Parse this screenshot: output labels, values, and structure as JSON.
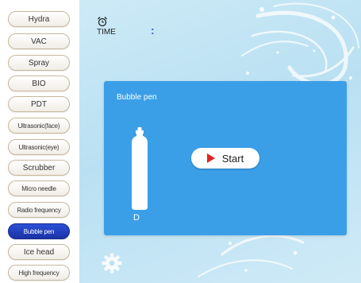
{
  "sidebar": {
    "items": [
      {
        "label": "Hydra"
      },
      {
        "label": "VAC"
      },
      {
        "label": "Spray"
      },
      {
        "label": "BIO"
      },
      {
        "label": "PDT"
      },
      {
        "label": "Ultrasonic(face)"
      },
      {
        "label": "Ultrasonic(eye)"
      },
      {
        "label": "Scrubber"
      },
      {
        "label": "Micro needle"
      },
      {
        "label": "Radio frequency"
      },
      {
        "label": "Bubble pen",
        "active": true
      },
      {
        "label": "Ice head"
      },
      {
        "label": "High frequency"
      }
    ]
  },
  "header": {
    "time_label": "TIME",
    "time_value": ":",
    "clock_icon": "alarm-clock-icon"
  },
  "panel": {
    "title": "Bubble pen",
    "pen_label": "D",
    "pen_icon": "bottle-icon",
    "start_label": "Start",
    "start_icon": "play-icon"
  },
  "footer": {
    "settings_icon": "gear-icon"
  },
  "colors": {
    "active_button": "#1f3fc4",
    "panel_bg": "#3b9fe8",
    "play_icon": "#e02424"
  }
}
